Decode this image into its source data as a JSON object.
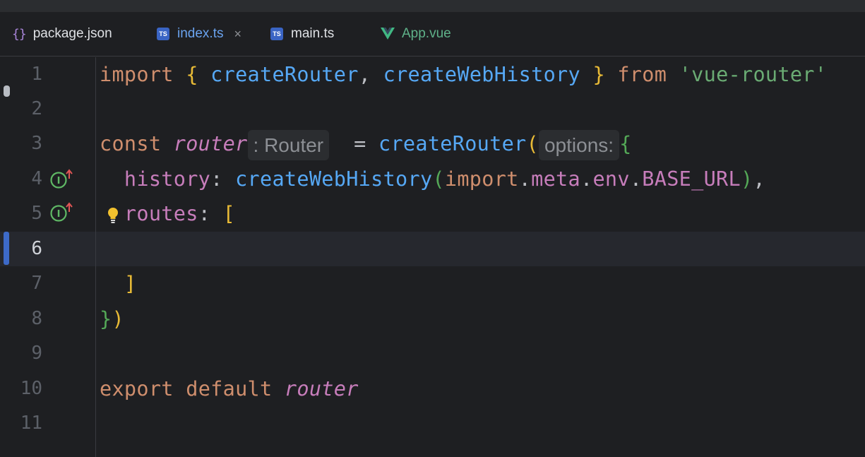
{
  "tabs": [
    {
      "label": "package.json",
      "icon": "json-icon",
      "active": false
    },
    {
      "label": "index.ts",
      "icon": "typescript-icon",
      "active": true,
      "closable": true
    },
    {
      "label": "main.ts",
      "icon": "typescript-icon",
      "active": false
    },
    {
      "label": "App.vue",
      "icon": "vue-icon",
      "active": false
    }
  ],
  "ts_icon_text": "TS",
  "close_glyph": "×",
  "editor": {
    "current_line": 6,
    "line_numbers": [
      "1",
      "2",
      "3",
      "4",
      "5",
      "6",
      "7",
      "8",
      "9",
      "10",
      "11"
    ],
    "lines": {
      "l1": {
        "kw_import": "import",
        "open": "{",
        "fn1": "createRouter",
        "comma": ",",
        "fn2": "createWebHistory",
        "close": "}",
        "kw_from": "from",
        "str": "'vue-router'"
      },
      "l3": {
        "kw_const": "const",
        "var": "router",
        "hint": ": Router",
        "eq": "=",
        "fn": "createRouter",
        "paren": "(",
        "hint2": "options:",
        "brace": "{"
      },
      "l4": {
        "prop": "history",
        "colon": ":",
        "fn": "createWebHistory",
        "paren_open": "(",
        "kw": "import",
        "dot1": ".",
        "meta": "meta",
        "dot2": ".",
        "env": "env",
        "dot3": ".",
        "base": "BASE_URL",
        "paren_close": ")",
        "comma": ","
      },
      "l5": {
        "prop": "routes",
        "colon": ":",
        "bracket": "["
      },
      "l7": {
        "bracket": "]"
      },
      "l8": {
        "brace": "}",
        "paren": ")"
      },
      "l10": {
        "kw_export": "export",
        "kw_default": "default",
        "var": "router"
      }
    }
  },
  "colors": {
    "background": "#1e1f22",
    "keyword": "#cf8e6d",
    "function": "#56a8f5",
    "string": "#6aab73",
    "property": "#c77dbb",
    "bracket": "#e8ba36",
    "accent": "#3574f0"
  }
}
